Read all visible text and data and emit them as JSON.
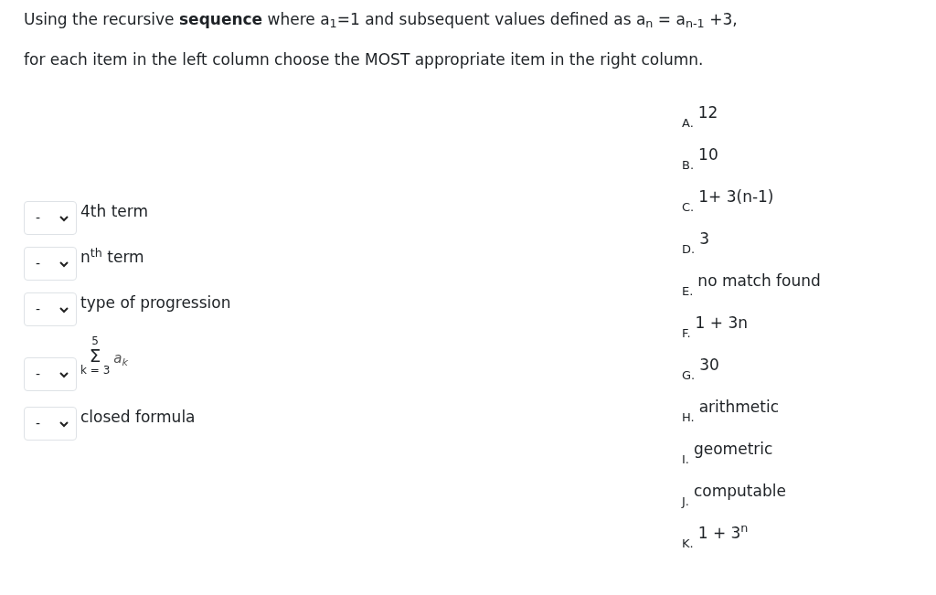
{
  "instructions": [
    "Using the recursive **sequence** where a$_{1}$=1 and subsequent values defined as a$_{n}$ = a$_{n-1}$ +3,",
    "for each item in the left column choose the MOST appropriate item in the right column."
  ],
  "left_items": [
    {
      "kind": "text",
      "select_value": "-",
      "label": "4th term"
    },
    {
      "kind": "text",
      "select_value": "-",
      "label": "n$^{th}$ term"
    },
    {
      "kind": "text",
      "select_value": "-",
      "label": "type of progression"
    },
    {
      "kind": "sum",
      "select_value": "-",
      "upper": "5",
      "symbol": "Σ",
      "lower": "k = 3",
      "term": "a$_{k}$"
    },
    {
      "kind": "text",
      "select_value": "-",
      "label": "closed formula"
    }
  ],
  "right_items": [
    {
      "letter": "A.",
      "text": "12"
    },
    {
      "letter": "B.",
      "text": "10"
    },
    {
      "letter": "C.",
      "text": "1+ 3(n-1)"
    },
    {
      "letter": "D.",
      "text": "3"
    },
    {
      "letter": "E.",
      "text": "no match found"
    },
    {
      "letter": "F.",
      "text": "1 + 3n"
    },
    {
      "letter": "G.",
      "text": "30"
    },
    {
      "letter": "H.",
      "text": "arithmetic"
    },
    {
      "letter": "I.",
      "text": "geometric"
    },
    {
      "letter": "J.",
      "text": "computable"
    },
    {
      "letter": "K.",
      "text": "1 + 3$^{n}$"
    }
  ]
}
